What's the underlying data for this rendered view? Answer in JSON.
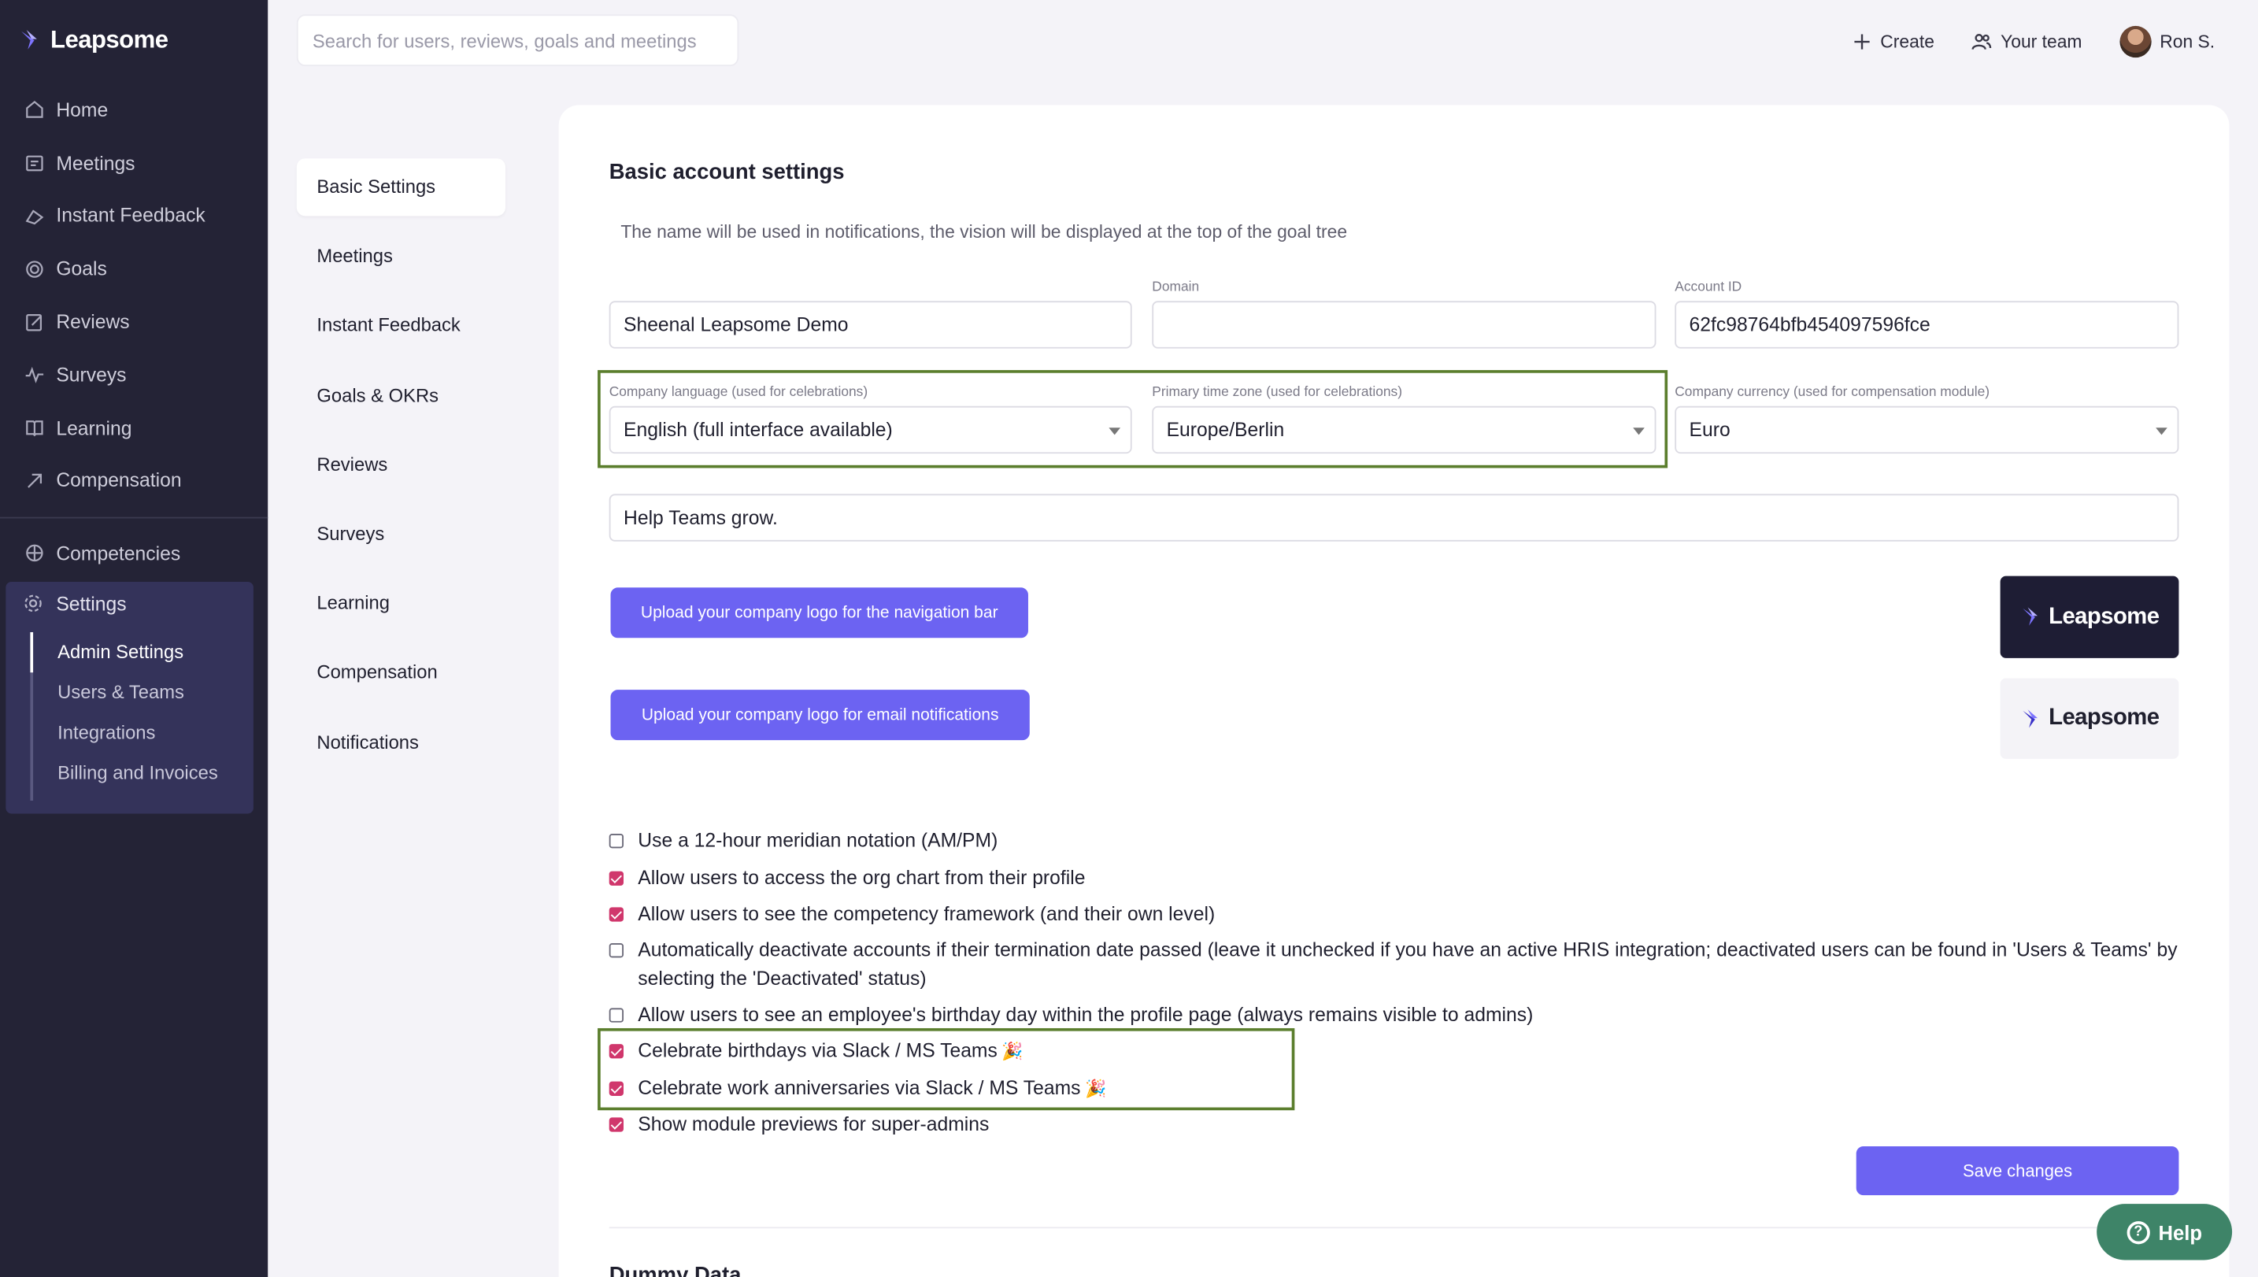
{
  "app": {
    "brand": "Leapsome"
  },
  "search": {
    "placeholder": "Search for users, reviews, goals and meetings"
  },
  "topbar": {
    "create": "Create",
    "your_team": "Your team",
    "user": "Ron S."
  },
  "sidebar": {
    "items": [
      {
        "label": "Home",
        "icon": "home-icon"
      },
      {
        "label": "Meetings",
        "icon": "meetings-icon"
      },
      {
        "label": "Instant Feedback",
        "icon": "feedback-icon"
      },
      {
        "label": "Goals",
        "icon": "goals-icon"
      },
      {
        "label": "Reviews",
        "icon": "reviews-icon"
      },
      {
        "label": "Surveys",
        "icon": "surveys-icon"
      },
      {
        "label": "Learning",
        "icon": "learning-icon"
      },
      {
        "label": "Compensation",
        "icon": "compensation-icon"
      }
    ],
    "items2": [
      {
        "label": "Competencies",
        "icon": "competencies-icon"
      }
    ],
    "settings": {
      "label": "Settings",
      "sub": [
        "Admin Settings",
        "Users & Teams",
        "Integrations",
        "Billing and Invoices"
      ]
    }
  },
  "settings_nav": [
    "Basic Settings",
    "Meetings",
    "Instant Feedback",
    "Goals & OKRs",
    "Reviews",
    "Surveys",
    "Learning",
    "Compensation",
    "Notifications"
  ],
  "card": {
    "title": "Basic account settings",
    "subtitle": "The name will be used in notifications, the vision will be displayed at the top of the goal tree",
    "company_name": "Sheenal Leapsome Demo",
    "domain_label": "Domain",
    "domain_value": "",
    "account_id_label": "Account ID",
    "account_id": "62fc98764bfb454097596fce",
    "language_label": "Company language (used for celebrations)",
    "language": "English (full interface available)",
    "timezone_label": "Primary time zone (used for celebrations)",
    "timezone": "Europe/Berlin",
    "currency_label": "Company currency (used for compensation module)",
    "currency": "Euro",
    "vision": "Help Teams grow.",
    "upload_nav": "Upload your company logo for the navigation bar",
    "upload_email": "Upload your company logo for email notifications",
    "checkboxes": [
      {
        "label": "Use a 12-hour meridian notation (AM/PM)",
        "checked": false
      },
      {
        "label": "Allow users to access the org chart from their profile",
        "checked": true
      },
      {
        "label": "Allow users to see the competency framework (and their own level)",
        "checked": true
      },
      {
        "label": "Automatically deactivate accounts if their termination date passed (leave it unchecked if you have an active HRIS integration; deactivated users can be found in 'Users & Teams' by selecting the 'Deactivated' status)",
        "checked": false
      },
      {
        "label": "Allow users to see an employee's birthday day within the profile page (always remains visible to admins)",
        "checked": false
      },
      {
        "label": "Celebrate birthdays via Slack / MS Teams",
        "checked": true,
        "emoji": "🎉"
      },
      {
        "label": "Celebrate work anniversaries via Slack / MS Teams",
        "checked": true,
        "emoji": "🎉"
      },
      {
        "label": "Show module previews for super-admins",
        "checked": true
      }
    ],
    "save": "Save changes",
    "next_section": "Dummy Data"
  },
  "help": "Help",
  "colors": {
    "sidebar": "#242336",
    "accent": "#6c63f2",
    "checkbox": "#d0376c",
    "highlight": "#5b7e2d",
    "help": "#3e8468"
  }
}
